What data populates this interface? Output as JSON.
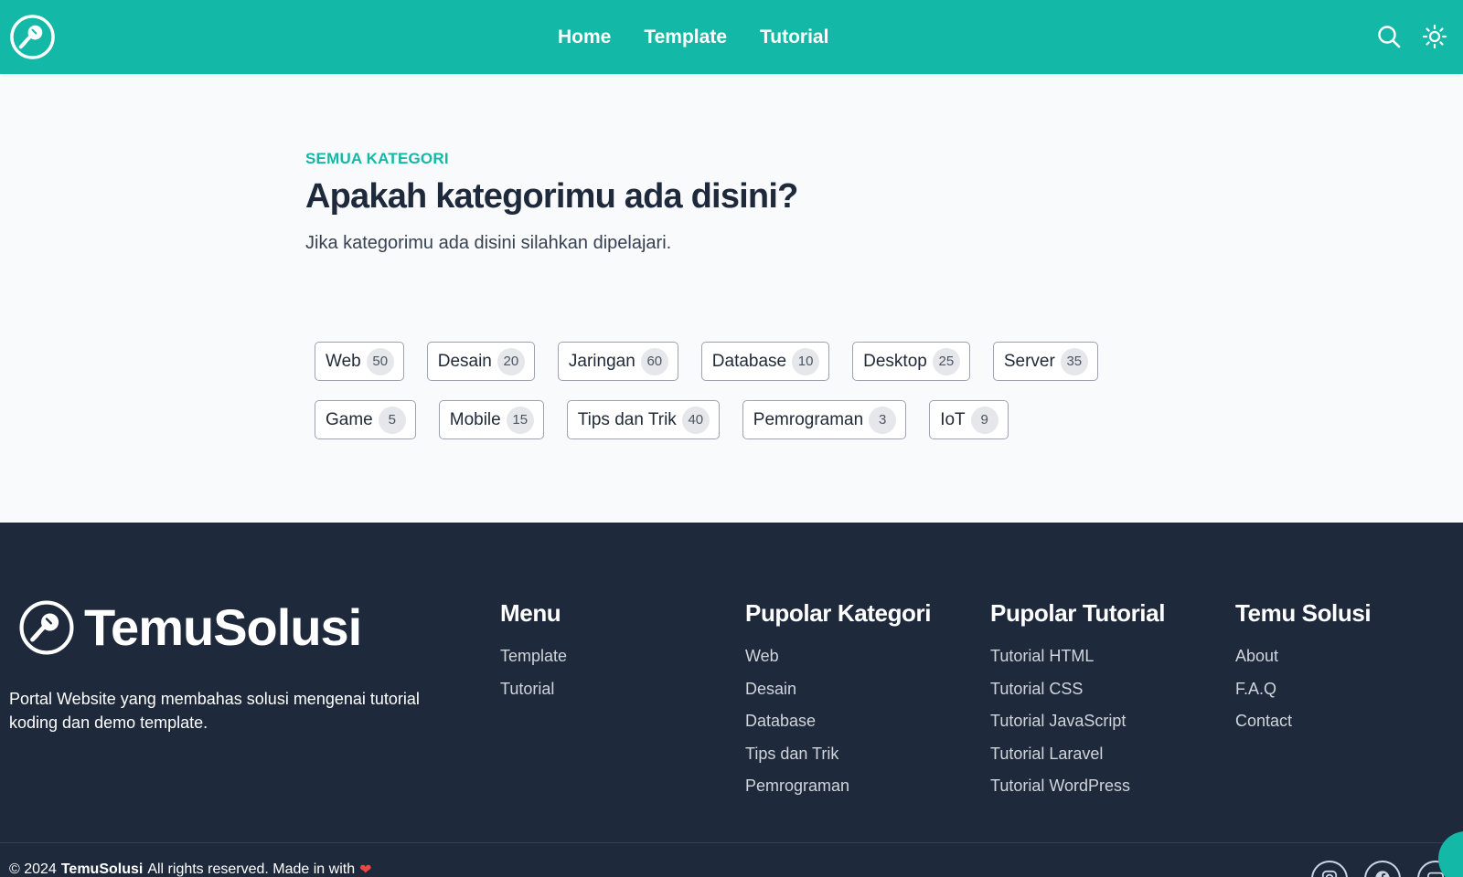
{
  "header": {
    "logo_icon": "lightbulb-logo-icon",
    "nav": [
      {
        "label": "Home"
      },
      {
        "label": "Template"
      },
      {
        "label": "Tutorial"
      }
    ],
    "search_icon": "search-icon",
    "theme_icon": "sun-icon",
    "bg_color": "#14b8a6"
  },
  "main": {
    "eyebrow": "SEMUA KATEGORI",
    "title": "Apakah kategorimu ada disini?",
    "subtitle": "Jika kategorimu ada disini silahkan dipelajari.",
    "categories": [
      {
        "label": "Web",
        "count": "50"
      },
      {
        "label": "Desain",
        "count": "20"
      },
      {
        "label": "Jaringan",
        "count": "60"
      },
      {
        "label": "Database",
        "count": "10"
      },
      {
        "label": "Desktop",
        "count": "25"
      },
      {
        "label": "Server",
        "count": "35"
      },
      {
        "label": "Game",
        "count": "5"
      },
      {
        "label": "Mobile",
        "count": "15"
      },
      {
        "label": "Tips dan Trik",
        "count": "40"
      },
      {
        "label": "Pemrograman",
        "count": "3"
      },
      {
        "label": "IoT",
        "count": "9"
      }
    ]
  },
  "footer": {
    "brand_name": "TemuSolusi",
    "description": "Portal Website yang membahas solusi mengenai tutorial koding dan demo template.",
    "columns": [
      {
        "title": "Menu",
        "items": [
          "Template",
          "Tutorial"
        ]
      },
      {
        "title": "Pupolar Kategori",
        "items": [
          "Web",
          "Desain",
          "Database",
          "Tips dan Trik",
          "Pemrograman"
        ]
      },
      {
        "title": "Pupolar Tutorial",
        "items": [
          "Tutorial HTML",
          "Tutorial CSS",
          "Tutorial JavaScript",
          "Tutorial Laravel",
          "Tutorial WordPress"
        ]
      },
      {
        "title": "Temu Solusi",
        "items": [
          "About",
          "F.A.Q",
          "Contact"
        ]
      }
    ],
    "copyright_prefix": "© 2024",
    "copyright_brand": "TemuSolusi",
    "copyright_suffix": "All rights reserved. Made in with",
    "heart_icon": "heart-icon",
    "social_icons": [
      "instagram-icon",
      "facebook-icon",
      "youtube-icon"
    ],
    "bg_color": "#1e293b"
  }
}
